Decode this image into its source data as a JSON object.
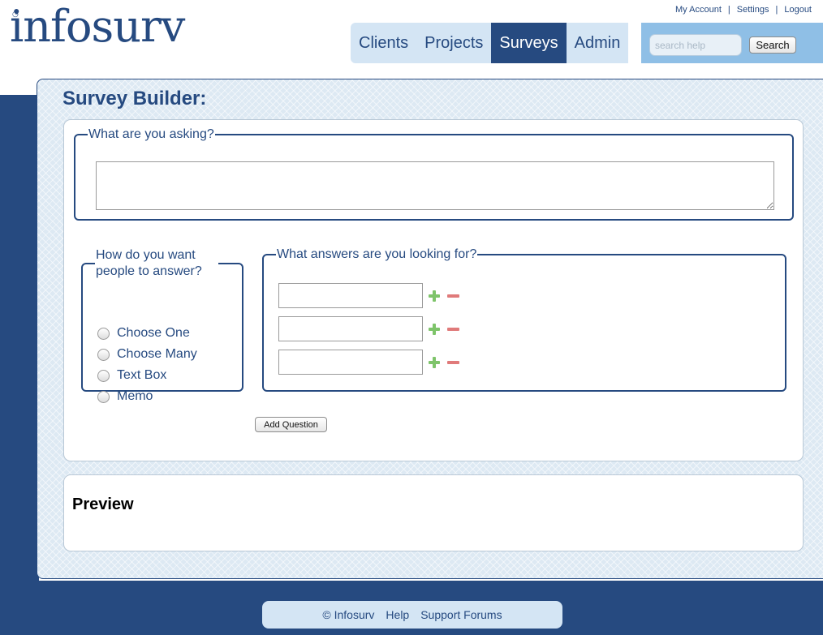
{
  "brand": {
    "logo_text": "infosurv"
  },
  "top_links": [
    "My Account",
    "Settings",
    "Logout"
  ],
  "nav": {
    "tabs": [
      {
        "label": "Clients"
      },
      {
        "label": "Projects"
      },
      {
        "label": "Surveys",
        "active": true
      },
      {
        "label": "Admin"
      }
    ]
  },
  "search": {
    "placeholder": "search help",
    "button_label": "Search"
  },
  "builder": {
    "title": "Survey Builder:",
    "question_legend": "What are you asking?",
    "question_value": "",
    "answer_type_legend": "How do you want people to answer?",
    "answer_types": [
      "Choose One",
      "Choose Many",
      "Text Box",
      "Memo"
    ],
    "answers_legend": "What answers are you looking for?",
    "answers": [
      "",
      "",
      ""
    ],
    "add_question_label": "Add Question"
  },
  "preview": {
    "title": "Preview"
  },
  "footer": {
    "copyright": "© Infosurv",
    "help": "Help",
    "support": "Support Forums"
  },
  "colors": {
    "navy": "#264a80",
    "light_blue": "#d4e5f4",
    "search_bar": "#8fbfe6",
    "plus": "#7ec46a",
    "minus": "#e07a7a"
  }
}
